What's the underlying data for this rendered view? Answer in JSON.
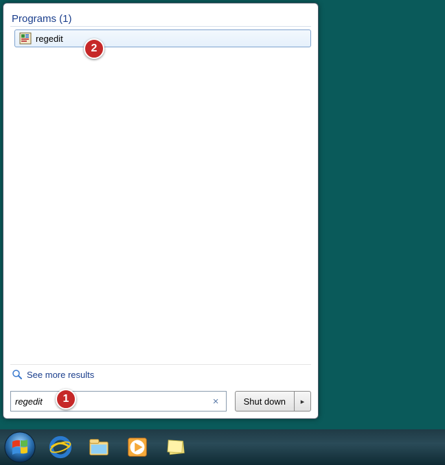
{
  "startMenu": {
    "categoryHeader": "Programs (1)",
    "result": {
      "label": "regedit"
    },
    "seeMore": "See more results",
    "search": {
      "value": "regedit"
    },
    "shutdown": {
      "label": "Shut down"
    }
  },
  "annotations": {
    "one": "1",
    "two": "2"
  }
}
